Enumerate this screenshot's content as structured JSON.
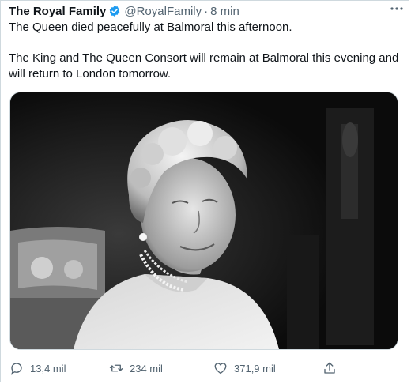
{
  "tweet": {
    "author_name": "The Royal Family",
    "handle": "@RoyalFamily",
    "separator": "·",
    "time": "8 min",
    "text_line1": "The Queen died peacefully at Balmoral this afternoon.",
    "text_line2": "The King and The Queen Consort will remain at Balmoral this evening and will return to London tomorrow.",
    "verified_color": "#1d9bf0"
  },
  "icons": {
    "more": "more-horizontal-icon",
    "verified": "verified-badge-icon",
    "reply": "reply-icon",
    "retweet": "retweet-icon",
    "like": "heart-icon",
    "share": "share-icon"
  },
  "actions": {
    "replies": "13,4 mil",
    "retweets": "234 mil",
    "likes": "371,9 mil"
  }
}
